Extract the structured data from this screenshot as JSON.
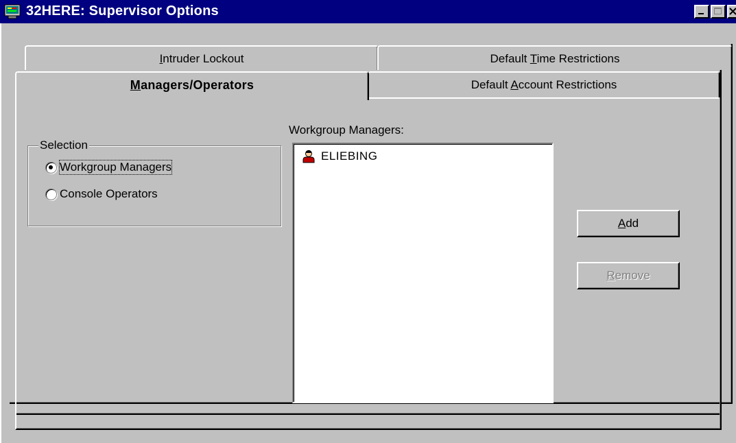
{
  "window": {
    "title": "32HERE: Supervisor Options",
    "icon": "app-monitor-icon",
    "controls": [
      "minimize-icon",
      "maximize-icon",
      "close-icon"
    ]
  },
  "tabs": {
    "back_row": [
      {
        "label": "Intruder Lockout",
        "mnemonic": "I"
      },
      {
        "label": "Default Time Restrictions",
        "mnemonic": "T"
      }
    ],
    "front_row": [
      {
        "label": "Managers/Operators",
        "mnemonic": "M",
        "active": true
      },
      {
        "label": "Default Account Restrictions",
        "mnemonic": "A"
      }
    ]
  },
  "selection": {
    "legend": "Selection",
    "options": [
      {
        "label": "Workgroup Managers",
        "selected": true
      },
      {
        "label": "Console Operators",
        "selected": false
      }
    ]
  },
  "list": {
    "label": "Workgroup Managers:",
    "items": [
      {
        "name": "ELIEBING",
        "icon": "user-icon"
      }
    ]
  },
  "buttons": {
    "add": {
      "label": "Add",
      "mnemonic": "A",
      "enabled": true
    },
    "remove": {
      "label": "Remove",
      "mnemonic": "R",
      "enabled": false
    }
  },
  "colors": {
    "title_bar": "#000080",
    "face": "#c0c0c0",
    "user_icon_red": "#c00000"
  }
}
